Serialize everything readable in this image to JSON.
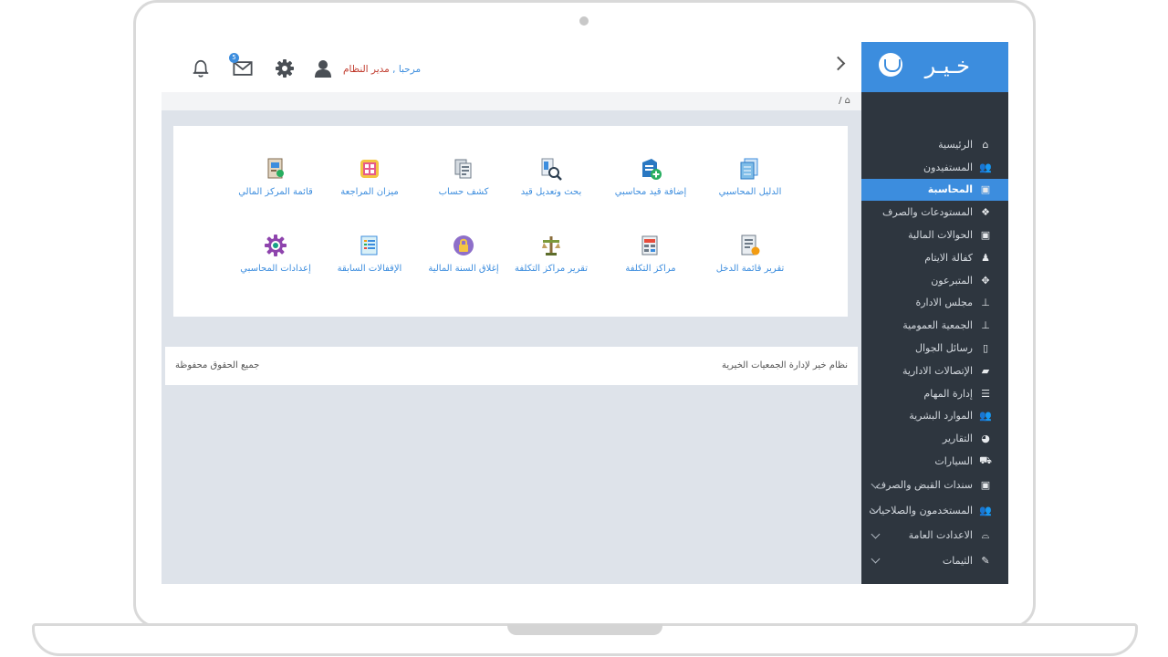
{
  "brand": {
    "logo_text": "خـيـر"
  },
  "header": {
    "greeting": "مرحبا ,",
    "user_name": "مدير النظام",
    "mail_count": "5"
  },
  "breadcrumb": {
    "text": "/"
  },
  "tiles": [
    {
      "label": "الدليل المحاسبي",
      "icon": "accounting-guide-icon"
    },
    {
      "label": "إضافة قيد محاسبي",
      "icon": "add-entry-icon"
    },
    {
      "label": "بحث وتعديل قيد",
      "icon": "search-entry-icon"
    },
    {
      "label": "كشف حساب",
      "icon": "account-statement-icon"
    },
    {
      "label": "ميزان المراجعة",
      "icon": "trial-balance-icon"
    },
    {
      "label": "قائمة المركز المالي",
      "icon": "balance-sheet-icon"
    },
    {
      "label": "تقرير قائمة الدخل",
      "icon": "income-report-icon"
    },
    {
      "label": "مراكز التكلفة",
      "icon": "cost-centers-icon"
    },
    {
      "label": "تقرير مراكز التكلفة",
      "icon": "cost-centers-report-icon"
    },
    {
      "label": "إغلاق السنة المالية",
      "icon": "close-year-icon"
    },
    {
      "label": "الإقفالات السابقة",
      "icon": "previous-closings-icon"
    },
    {
      "label": "إعدادات المحاسبي",
      "icon": "accounting-settings-icon"
    }
  ],
  "footer": {
    "system_name": "نظام خير لإدارة الجمعيات الخيرية",
    "rights": "جميع الحقوق محفوظة"
  },
  "menu": [
    {
      "label": "الرئيسية",
      "icon": "home-icon",
      "glyph": "⌂"
    },
    {
      "label": "المستفيدون",
      "icon": "users-icon",
      "glyph": "👥"
    },
    {
      "label": "المحاسبة",
      "icon": "money-icon",
      "glyph": "▣",
      "active": true
    },
    {
      "label": "المستودعات والصرف",
      "icon": "cubes-icon",
      "glyph": "❖"
    },
    {
      "label": "الحوالات المالية",
      "icon": "money-icon",
      "glyph": "▣"
    },
    {
      "label": "كفالة الايتام",
      "icon": "child-icon",
      "glyph": "♟"
    },
    {
      "label": "المتبرعون",
      "icon": "crosshair-icon",
      "glyph": "✥"
    },
    {
      "label": "مجلس الادارة",
      "icon": "sitemap-icon",
      "glyph": "⊥"
    },
    {
      "label": "الجمعية العمومية",
      "icon": "sitemap-icon",
      "glyph": "⊥"
    },
    {
      "label": "رسائل الجوال",
      "icon": "mobile-icon",
      "glyph": "▯"
    },
    {
      "label": "الإتصالات الادارية",
      "icon": "folder-icon",
      "glyph": "▰"
    },
    {
      "label": "إدارة المهام",
      "icon": "tasks-icon",
      "glyph": "☰"
    },
    {
      "label": "الموارد البشرية",
      "icon": "users-icon",
      "glyph": "👥"
    },
    {
      "label": "التقارير",
      "icon": "pie-chart-icon",
      "glyph": "◕"
    },
    {
      "label": "السيارات",
      "icon": "car-icon",
      "glyph": "⛟"
    },
    {
      "label": "سندات القبض والصرف",
      "icon": "money-icon",
      "glyph": "▣",
      "caret": true
    },
    {
      "label": "المستخدمون والصلاحيات",
      "icon": "users-icon",
      "glyph": "👥",
      "caret": true
    },
    {
      "label": "الاعدادت العامة",
      "icon": "hdd-icon",
      "glyph": "⌓",
      "caret": true
    },
    {
      "label": "الثيمات",
      "icon": "brush-icon",
      "glyph": "✎",
      "caret": true
    }
  ],
  "colors": {
    "accent": "#3c8dde",
    "sidebar": "#2e363f",
    "username": "#c0392b"
  }
}
